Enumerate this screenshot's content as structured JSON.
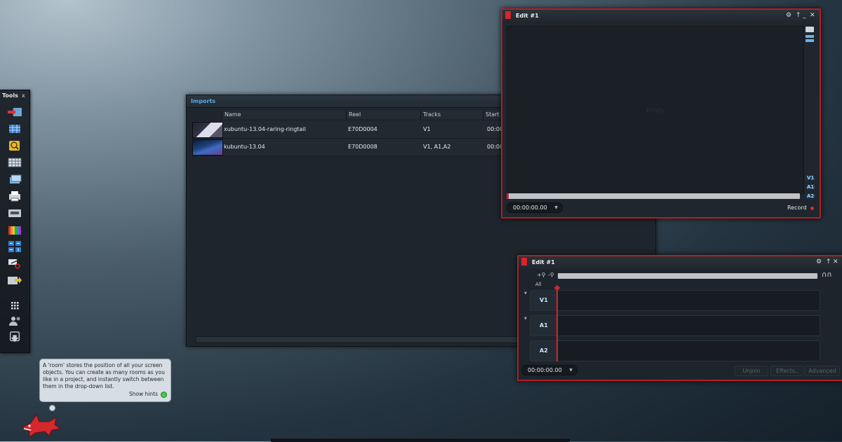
{
  "tools": {
    "title": "Tools",
    "close": "x",
    "items": [
      {
        "name": "import",
        "icon": "import-arrow-icon"
      },
      {
        "name": "project",
        "icon": "grid-table-icon"
      },
      {
        "name": "search",
        "icon": "magnifier-icon"
      },
      {
        "name": "bin",
        "icon": "spreadsheet-icon"
      },
      {
        "name": "sequence",
        "icon": "stack-icon"
      },
      {
        "name": "print",
        "icon": "printer-icon"
      },
      {
        "name": "output",
        "icon": "tape-deck-icon"
      },
      {
        "name": "color",
        "icon": "color-bars-icon"
      },
      {
        "name": "calculator",
        "icon": "calculator-icon"
      },
      {
        "name": "cut",
        "icon": "scissors-icon"
      },
      {
        "name": "export",
        "icon": "export-folder-icon"
      },
      {
        "name": "rooms",
        "icon": "apps-grid-icon"
      },
      {
        "name": "users",
        "icon": "users-icon"
      },
      {
        "name": "exit",
        "icon": "exit-icon"
      }
    ]
  },
  "imports": {
    "title": "Imports",
    "columns": [
      "Name",
      "Reel",
      "Tracks",
      "Start"
    ],
    "rows": [
      {
        "name": "xubuntu-13.04-raring-ringtail",
        "reel": "E70D0004",
        "tracks": "V1",
        "start": "00:00"
      },
      {
        "name": "kubuntu-13.04",
        "reel": "E70D0008",
        "tracks": "V1, A1,A2",
        "start": "00:00"
      }
    ]
  },
  "viewer": {
    "title": "Edit #1",
    "empty": "Empty",
    "timecode": "00:00:00.00",
    "record": "Record",
    "tracks": [
      "V1",
      "A1",
      "A2"
    ]
  },
  "timeline": {
    "title": "Edit #1",
    "all": "All",
    "timecode": "00:00:00.00",
    "tracks": [
      "V1",
      "A1",
      "A2"
    ],
    "buttons": {
      "unjoin": "Unjoin",
      "effects": "Effects..",
      "advanced": "Advanced"
    }
  },
  "hint": {
    "text": "A 'room' stores the position of all your screen objects.  You can create as many rooms as you like in a project, and instantly switch between them in the drop-down list.",
    "show_hints": "Show hints"
  },
  "colors": {
    "accent_red": "#b11f24",
    "title_blue": "#5aa9e6",
    "hint_green": "#4bc64b"
  }
}
